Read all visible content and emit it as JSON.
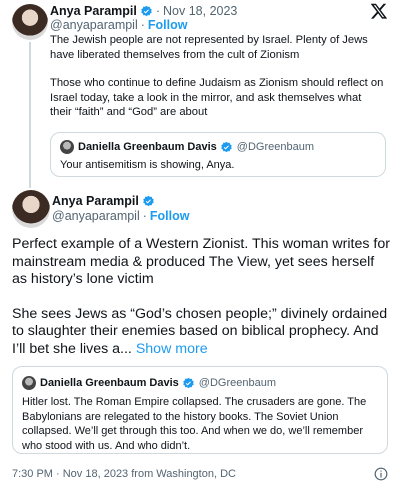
{
  "tweet1": {
    "name": "Anya Parampil",
    "handle": "@anyaparampil",
    "separator": "·",
    "date": "Nov 18, 2023",
    "follow_label": "Follow",
    "paragraph1": "The Jewish people are not represented by Israel. Plenty of Jews have liberated themselves from the cult of Zionism",
    "paragraph2": "Those who continue to define Judaism as Zionism should reflect on Israel today, take a look in the mirror, and ask themselves what their “faith” and “God” are about",
    "quote": {
      "name": "Daniella Greenbaum Davis",
      "handle": "@DGreenbaum",
      "text": "Your antisemitism is showing, Anya."
    }
  },
  "tweet2": {
    "name": "Anya Parampil",
    "handle": "@anyaparampil",
    "separator": "·",
    "follow_label": "Follow",
    "paragraph1": "Perfect example of a Western Zionist. This woman writes for mainstream media & produced The View, yet sees herself as history’s lone victim",
    "paragraph2": "She sees Jews as “God’s chosen people;” divinely ordained to slaughter their enemies based on biblical prophecy. And I’ll bet she lives a...",
    "show_more": "Show more",
    "quote": {
      "name": "Daniella Greenbaum Davis",
      "handle": "@DGreenbaum",
      "text": "Hitler lost. The Roman Empire collapsed. The crusaders are gone. The Babylonians are relegated to the history books. The Soviet Union collapsed. We’ll get through this too. And when we do, we’ll remember who stood with us. And who didn’t."
    },
    "timestamp": "7:30 PM · Nov 18, 2023 from Washington, DC"
  },
  "icons": {
    "verified": "verified-badge-icon",
    "x_logo": "x-logo-icon",
    "info": "info-icon"
  },
  "colors": {
    "accent": "#1d9bf0",
    "text": "#0f1419",
    "muted": "#536471",
    "border": "#cfd9de"
  }
}
